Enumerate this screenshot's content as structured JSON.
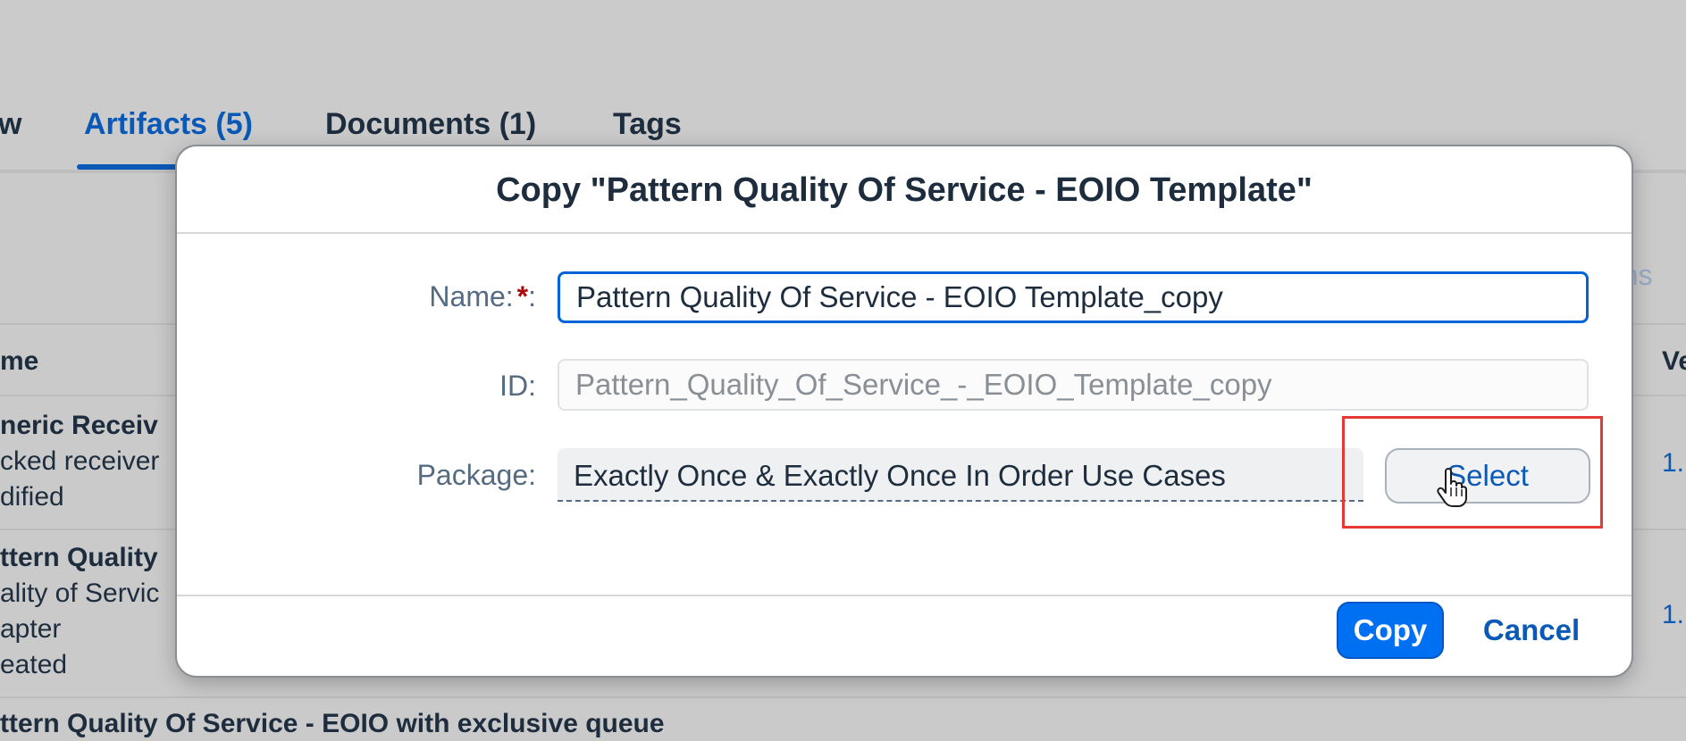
{
  "tabs": [
    {
      "label": "w"
    },
    {
      "label": "Artifacts (5)"
    },
    {
      "label": "Documents (1)"
    },
    {
      "label": "Tags"
    }
  ],
  "toolbar": {
    "actions_partial": "tions"
  },
  "table": {
    "col_name_partial": "me",
    "col_version_partial": "Ve",
    "rows": [
      {
        "title": "neric Receiv",
        "line2": "cked receiver",
        "line3": "dified",
        "version": "1."
      },
      {
        "title": "ttern Quality",
        "line2": "ality of Servic",
        "line3": "apter",
        "line4": "eated",
        "version": "1."
      },
      {
        "title": "ttern Quality Of Service - EOIO with exclusive queue"
      }
    ]
  },
  "dialog": {
    "title": "Copy \"Pattern Quality Of Service - EOIO Template\"",
    "name_label": "Name:",
    "required_marker": "*",
    "name_colon": ":",
    "name_value": "Pattern Quality Of Service - EOIO Template_copy",
    "id_label": "ID:",
    "id_placeholder": "Pattern_Quality_Of_Service_-_EOIO_Template_copy",
    "package_label": "Package:",
    "package_value": "Exactly Once & Exactly Once In Order Use Cases",
    "select_label": "Select",
    "copy_label": "Copy",
    "cancel_label": "Cancel"
  },
  "colors": {
    "accent": "#0a59b7",
    "primary_button": "#0070f2",
    "required": "#aa0808",
    "highlight": "#e53935"
  }
}
